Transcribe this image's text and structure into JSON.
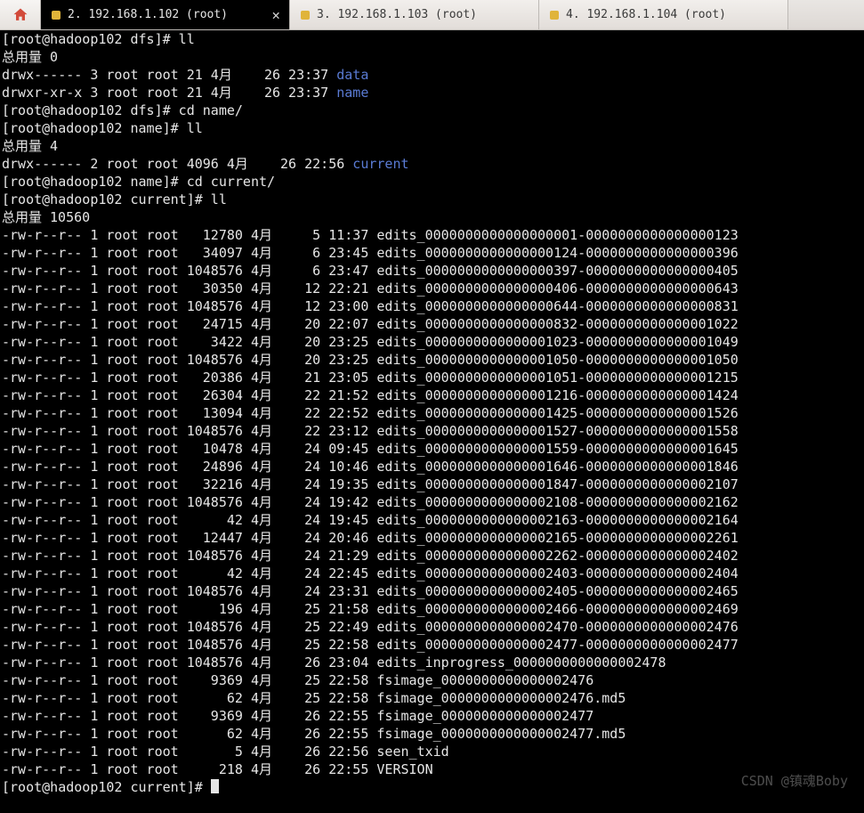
{
  "tabs": [
    {
      "label": "2. 192.168.1.102 (root)",
      "active": true
    },
    {
      "label": "3. 192.168.1.103 (root)",
      "active": false
    },
    {
      "label": "4. 192.168.1.104 (root)",
      "active": false
    }
  ],
  "colors": {
    "dir": "#5a7bd4",
    "fg": "#e6e6e6",
    "bg": "#000000"
  },
  "prompts": {
    "p1": {
      "user": "root",
      "host": "hadoop102",
      "cwd": "dfs",
      "cmd": "ll"
    },
    "p2": {
      "user": "root",
      "host": "hadoop102",
      "cwd": "dfs",
      "cmd": "cd name/"
    },
    "p3": {
      "user": "root",
      "host": "hadoop102",
      "cwd": "name",
      "cmd": "ll"
    },
    "p4": {
      "user": "root",
      "host": "hadoop102",
      "cwd": "name",
      "cmd": "cd current/"
    },
    "p5": {
      "user": "root",
      "host": "hadoop102",
      "cwd": "current",
      "cmd": "ll"
    },
    "p6": {
      "user": "root",
      "host": "hadoop102",
      "cwd": "current",
      "cmd": ""
    }
  },
  "totals": {
    "t1": "总用量 0",
    "t2": "总用量 4",
    "t3": "总用量 10560"
  },
  "ls_dfs": [
    {
      "perm": "drwx------",
      "links": "3",
      "owner": "root",
      "group": "root",
      "size": "21",
      "month": "4月",
      "day": "26",
      "time": "23:37",
      "name": "data",
      "is_dir": true
    },
    {
      "perm": "drwxr-xr-x",
      "links": "3",
      "owner": "root",
      "group": "root",
      "size": "21",
      "month": "4月",
      "day": "26",
      "time": "23:37",
      "name": "name",
      "is_dir": true
    }
  ],
  "ls_name": [
    {
      "perm": "drwx------",
      "links": "2",
      "owner": "root",
      "group": "root",
      "size": "4096",
      "month": "4月",
      "day": "26",
      "time": "22:56",
      "name": "current",
      "is_dir": true
    }
  ],
  "ls_current": [
    {
      "perm": "-rw-r--r--",
      "links": "1",
      "owner": "root",
      "group": "root",
      "size": "12780",
      "month": "4月",
      "day": "5",
      "time": "11:37",
      "name": "edits_0000000000000000001-0000000000000000123"
    },
    {
      "perm": "-rw-r--r--",
      "links": "1",
      "owner": "root",
      "group": "root",
      "size": "34097",
      "month": "4月",
      "day": "6",
      "time": "23:45",
      "name": "edits_0000000000000000124-0000000000000000396"
    },
    {
      "perm": "-rw-r--r--",
      "links": "1",
      "owner": "root",
      "group": "root",
      "size": "1048576",
      "month": "4月",
      "day": "6",
      "time": "23:47",
      "name": "edits_0000000000000000397-0000000000000000405"
    },
    {
      "perm": "-rw-r--r--",
      "links": "1",
      "owner": "root",
      "group": "root",
      "size": "30350",
      "month": "4月",
      "day": "12",
      "time": "22:21",
      "name": "edits_0000000000000000406-0000000000000000643"
    },
    {
      "perm": "-rw-r--r--",
      "links": "1",
      "owner": "root",
      "group": "root",
      "size": "1048576",
      "month": "4月",
      "day": "12",
      "time": "23:00",
      "name": "edits_0000000000000000644-0000000000000000831"
    },
    {
      "perm": "-rw-r--r--",
      "links": "1",
      "owner": "root",
      "group": "root",
      "size": "24715",
      "month": "4月",
      "day": "20",
      "time": "22:07",
      "name": "edits_0000000000000000832-0000000000000001022"
    },
    {
      "perm": "-rw-r--r--",
      "links": "1",
      "owner": "root",
      "group": "root",
      "size": "3422",
      "month": "4月",
      "day": "20",
      "time": "23:25",
      "name": "edits_0000000000000001023-0000000000000001049"
    },
    {
      "perm": "-rw-r--r--",
      "links": "1",
      "owner": "root",
      "group": "root",
      "size": "1048576",
      "month": "4月",
      "day": "20",
      "time": "23:25",
      "name": "edits_0000000000000001050-0000000000000001050"
    },
    {
      "perm": "-rw-r--r--",
      "links": "1",
      "owner": "root",
      "group": "root",
      "size": "20386",
      "month": "4月",
      "day": "21",
      "time": "23:05",
      "name": "edits_0000000000000001051-0000000000000001215"
    },
    {
      "perm": "-rw-r--r--",
      "links": "1",
      "owner": "root",
      "group": "root",
      "size": "26304",
      "month": "4月",
      "day": "22",
      "time": "21:52",
      "name": "edits_0000000000000001216-0000000000000001424"
    },
    {
      "perm": "-rw-r--r--",
      "links": "1",
      "owner": "root",
      "group": "root",
      "size": "13094",
      "month": "4月",
      "day": "22",
      "time": "22:52",
      "name": "edits_0000000000000001425-0000000000000001526"
    },
    {
      "perm": "-rw-r--r--",
      "links": "1",
      "owner": "root",
      "group": "root",
      "size": "1048576",
      "month": "4月",
      "day": "22",
      "time": "23:12",
      "name": "edits_0000000000000001527-0000000000000001558"
    },
    {
      "perm": "-rw-r--r--",
      "links": "1",
      "owner": "root",
      "group": "root",
      "size": "10478",
      "month": "4月",
      "day": "24",
      "time": "09:45",
      "name": "edits_0000000000000001559-0000000000000001645"
    },
    {
      "perm": "-rw-r--r--",
      "links": "1",
      "owner": "root",
      "group": "root",
      "size": "24896",
      "month": "4月",
      "day": "24",
      "time": "10:46",
      "name": "edits_0000000000000001646-0000000000000001846"
    },
    {
      "perm": "-rw-r--r--",
      "links": "1",
      "owner": "root",
      "group": "root",
      "size": "32216",
      "month": "4月",
      "day": "24",
      "time": "19:35",
      "name": "edits_0000000000000001847-0000000000000002107"
    },
    {
      "perm": "-rw-r--r--",
      "links": "1",
      "owner": "root",
      "group": "root",
      "size": "1048576",
      "month": "4月",
      "day": "24",
      "time": "19:42",
      "name": "edits_0000000000000002108-0000000000000002162"
    },
    {
      "perm": "-rw-r--r--",
      "links": "1",
      "owner": "root",
      "group": "root",
      "size": "42",
      "month": "4月",
      "day": "24",
      "time": "19:45",
      "name": "edits_0000000000000002163-0000000000000002164"
    },
    {
      "perm": "-rw-r--r--",
      "links": "1",
      "owner": "root",
      "group": "root",
      "size": "12447",
      "month": "4月",
      "day": "24",
      "time": "20:46",
      "name": "edits_0000000000000002165-0000000000000002261"
    },
    {
      "perm": "-rw-r--r--",
      "links": "1",
      "owner": "root",
      "group": "root",
      "size": "1048576",
      "month": "4月",
      "day": "24",
      "time": "21:29",
      "name": "edits_0000000000000002262-0000000000000002402"
    },
    {
      "perm": "-rw-r--r--",
      "links": "1",
      "owner": "root",
      "group": "root",
      "size": "42",
      "month": "4月",
      "day": "24",
      "time": "22:45",
      "name": "edits_0000000000000002403-0000000000000002404"
    },
    {
      "perm": "-rw-r--r--",
      "links": "1",
      "owner": "root",
      "group": "root",
      "size": "1048576",
      "month": "4月",
      "day": "24",
      "time": "23:31",
      "name": "edits_0000000000000002405-0000000000000002465"
    },
    {
      "perm": "-rw-r--r--",
      "links": "1",
      "owner": "root",
      "group": "root",
      "size": "196",
      "month": "4月",
      "day": "25",
      "time": "21:58",
      "name": "edits_0000000000000002466-0000000000000002469"
    },
    {
      "perm": "-rw-r--r--",
      "links": "1",
      "owner": "root",
      "group": "root",
      "size": "1048576",
      "month": "4月",
      "day": "25",
      "time": "22:49",
      "name": "edits_0000000000000002470-0000000000000002476"
    },
    {
      "perm": "-rw-r--r--",
      "links": "1",
      "owner": "root",
      "group": "root",
      "size": "1048576",
      "month": "4月",
      "day": "25",
      "time": "22:58",
      "name": "edits_0000000000000002477-0000000000000002477"
    },
    {
      "perm": "-rw-r--r--",
      "links": "1",
      "owner": "root",
      "group": "root",
      "size": "1048576",
      "month": "4月",
      "day": "26",
      "time": "23:04",
      "name": "edits_inprogress_0000000000000002478"
    },
    {
      "perm": "-rw-r--r--",
      "links": "1",
      "owner": "root",
      "group": "root",
      "size": "9369",
      "month": "4月",
      "day": "25",
      "time": "22:58",
      "name": "fsimage_0000000000000002476"
    },
    {
      "perm": "-rw-r--r--",
      "links": "1",
      "owner": "root",
      "group": "root",
      "size": "62",
      "month": "4月",
      "day": "25",
      "time": "22:58",
      "name": "fsimage_0000000000000002476.md5"
    },
    {
      "perm": "-rw-r--r--",
      "links": "1",
      "owner": "root",
      "group": "root",
      "size": "9369",
      "month": "4月",
      "day": "26",
      "time": "22:55",
      "name": "fsimage_0000000000000002477"
    },
    {
      "perm": "-rw-r--r--",
      "links": "1",
      "owner": "root",
      "group": "root",
      "size": "62",
      "month": "4月",
      "day": "26",
      "time": "22:55",
      "name": "fsimage_0000000000000002477.md5"
    },
    {
      "perm": "-rw-r--r--",
      "links": "1",
      "owner": "root",
      "group": "root",
      "size": "5",
      "month": "4月",
      "day": "26",
      "time": "22:56",
      "name": "seen_txid"
    },
    {
      "perm": "-rw-r--r--",
      "links": "1",
      "owner": "root",
      "group": "root",
      "size": "218",
      "month": "4月",
      "day": "26",
      "time": "22:55",
      "name": "VERSION"
    }
  ],
  "watermark": "CSDN @镇魂Boby"
}
